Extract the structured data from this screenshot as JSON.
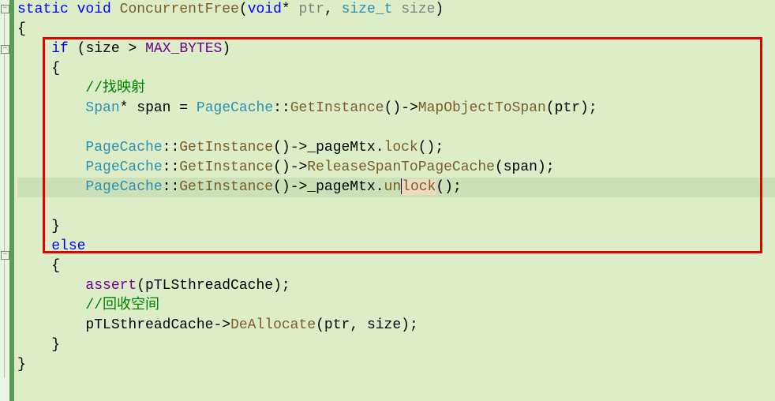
{
  "code": {
    "l1": {
      "kw1": "static",
      "kw2": "void",
      "fn": "ConcurrentFree",
      "p1type": "void",
      "p1star": "*",
      "p1name": "ptr",
      "comma": ",",
      "p2type": "size_t",
      "p2name": "size",
      "close": ")"
    },
    "l2": {
      "brace": "{"
    },
    "l3": {
      "kw": "if",
      "open": "(",
      "var": "size",
      "op": ">",
      "macro": "MAX_BYTES",
      "close": ")"
    },
    "l4": {
      "brace": "{"
    },
    "l5": {
      "comment": "//找映射"
    },
    "l6": {
      "type": "Span",
      "star": "*",
      "var": "span",
      "eq": "=",
      "cls": "PageCache",
      "scope": "::",
      "m1": "GetInstance",
      "p": "()",
      "arrow": "->",
      "m2": "MapObjectToSpan",
      "open": "(",
      "arg": "ptr",
      "close": ");"
    },
    "l7": {},
    "l8": {
      "cls": "PageCache",
      "scope": "::",
      "m1": "GetInstance",
      "p": "()",
      "arrow": "->",
      "mem": "_pageMtx",
      "dot": ".",
      "m2": "lock",
      "end": "();"
    },
    "l9": {
      "cls": "PageCache",
      "scope": "::",
      "m1": "GetInstance",
      "p": "()",
      "arrow": "->",
      "m2": "ReleaseSpanToPageCache",
      "open": "(",
      "arg": "span",
      "close": ");"
    },
    "l10": {
      "cls": "PageCache",
      "scope": "::",
      "m1": "GetInstance",
      "p": "()",
      "arrow": "->",
      "mem": "_pageMtx",
      "dot": ".",
      "m2a": "un",
      "m2b": "lock",
      "end": "();"
    },
    "l11": {},
    "l12": {
      "brace": "}"
    },
    "l13": {
      "kw": "else"
    },
    "l14": {
      "brace": "{"
    },
    "l15": {
      "fn": "assert",
      "open": "(",
      "arg": "pTLSthreadCache",
      "close": ");"
    },
    "l16": {
      "comment": "//回收空间"
    },
    "l17": {
      "var": "pTLSthreadCache",
      "arrow": "->",
      "m": "DeAllocate",
      "open": "(",
      "a1": "ptr",
      "comma": ",",
      "a2": "size",
      "close": ");"
    },
    "l18": {
      "brace": "}"
    },
    "l19": {
      "brace": "}"
    }
  },
  "fold": {
    "minus": "−"
  }
}
